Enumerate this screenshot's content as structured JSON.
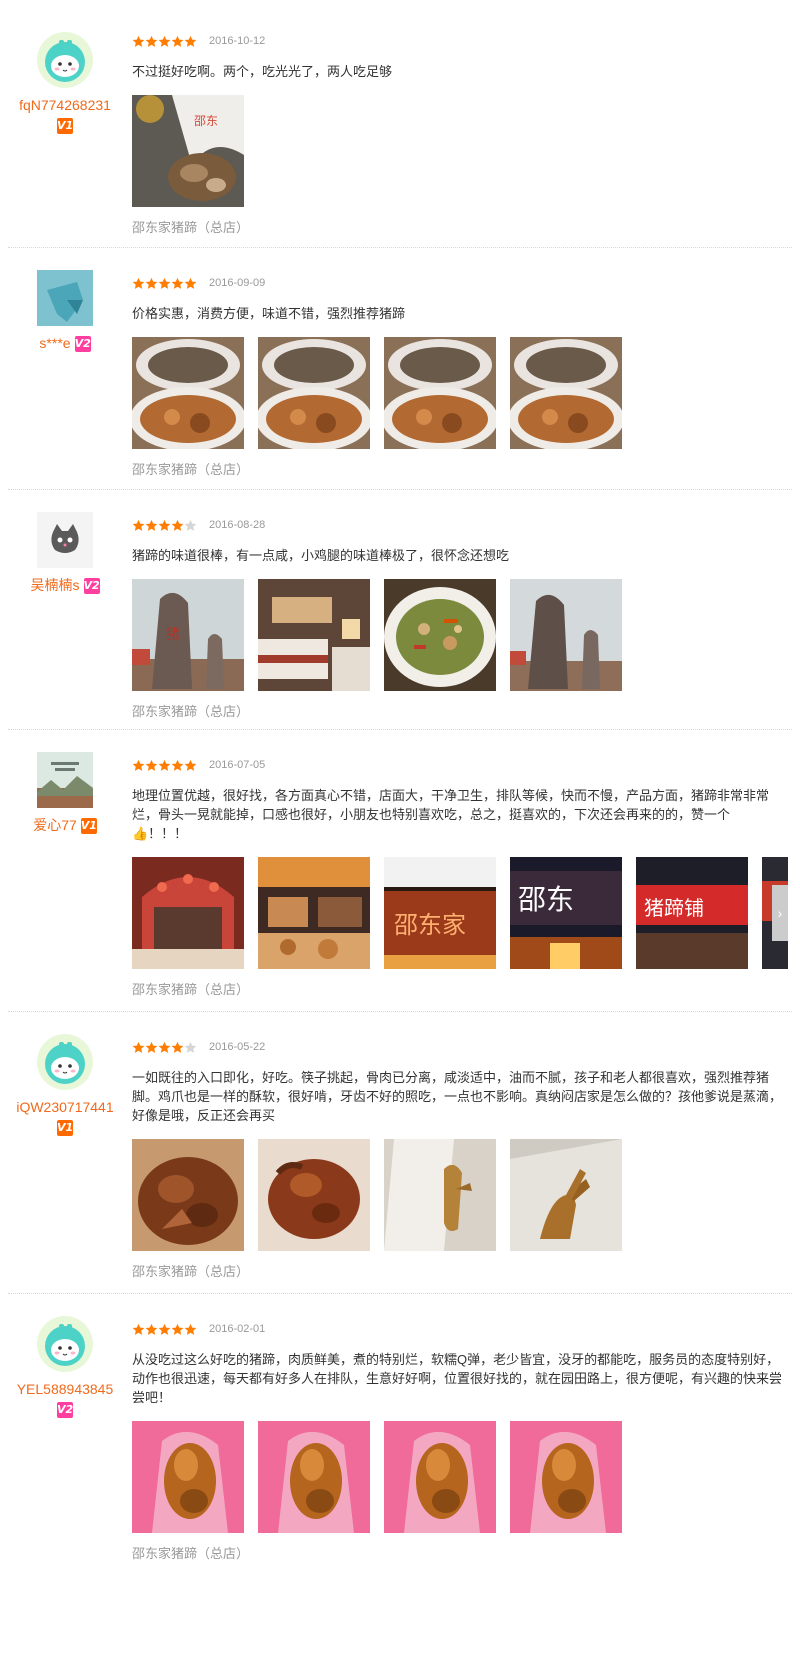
{
  "reviews": [
    {
      "username": "fqN774268231",
      "badge": "V1",
      "rating": 5,
      "date": "2016-10-12",
      "text": "不过挺好吃啊。两个，吃光光了，两人吃足够",
      "shop": "邵东家猪蹄（总店）",
      "photo_count": 1
    },
    {
      "username": "s***e",
      "badge": "V2",
      "rating": 5,
      "date": "2016-09-09",
      "text": "价格实惠，消费方便，味道不错，强烈推荐猪蹄",
      "shop": "邵东家猪蹄（总店）",
      "photo_count": 4
    },
    {
      "username": "吴楠楠s",
      "badge": "V2",
      "rating": 4,
      "date": "2016-08-28",
      "text": "猪蹄的味道很棒，有一点咸，小鸡腿的味道棒极了，很怀念还想吃",
      "shop": "邵东家猪蹄（总店）",
      "photo_count": 4
    },
    {
      "username": "爱心77",
      "badge": "V1",
      "rating": 5,
      "date": "2016-07-05",
      "text": "地理位置优越，很好找，各方面真心不错，店面大，干净卫生，排队等候，快而不慢，产品方面，猪蹄非常非常烂，骨头一晃就能掉，口感也很好，小朋友也特别喜欢吃，总之，挺喜欢的，下次还会再来的的，赞一个👍！！！",
      "shop": "邵东家猪蹄（总店）",
      "photo_count": 6,
      "carousel_next_icon": "chevron-right-icon"
    },
    {
      "username": "iQW230717441",
      "badge": "V1",
      "rating": 4,
      "date": "2016-05-22",
      "text": "一如既往的入口即化，好吃。筷子挑起，骨肉已分离，咸淡适中，油而不腻，孩子和老人都很喜欢，强烈推荐猪脚。鸡爪也是一样的酥软，很好啃，牙齿不好的照吃，一点也不影响。真纳闷店家是怎么做的？孩他爹说是蒸滴，好像是哦，反正还会再买",
      "shop": "邵东家猪蹄（总店）",
      "photo_count": 4
    },
    {
      "username": "YEL588943845",
      "badge": "V2",
      "rating": 5,
      "date": "2016-02-01",
      "text": "从没吃过这么好吃的猪蹄，肉质鲜美，煮的特别烂，软糯Q弹，老少皆宜，没牙的都能吃，服务员的态度特别好，动作也很迅速，每天都有好多人在排队，生意好好啊，位置很好找的，就在园田路上，很方便呢，有兴趣的快来尝尝吧！",
      "shop": "邵东家猪蹄（总店）",
      "photo_count": 4
    }
  ],
  "colors": {
    "star_on": "#ff7d00",
    "star_off": "#d6d6d6",
    "username": "#f06a1c",
    "meta": "#999999",
    "badge_v1": "#ff6a00",
    "badge_v2": "#ff3fa0"
  },
  "icons": {
    "star": "star-icon",
    "badge": "vip-badge-icon"
  }
}
